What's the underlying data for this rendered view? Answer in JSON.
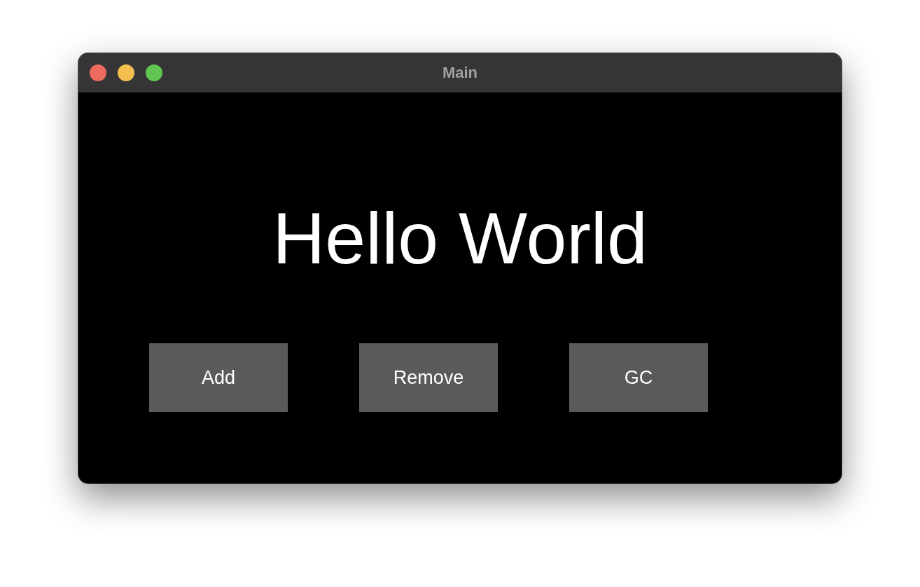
{
  "window": {
    "title": "Main"
  },
  "heading": "Hello World",
  "buttons": [
    {
      "label": "Add"
    },
    {
      "label": "Remove"
    },
    {
      "label": "GC"
    }
  ]
}
